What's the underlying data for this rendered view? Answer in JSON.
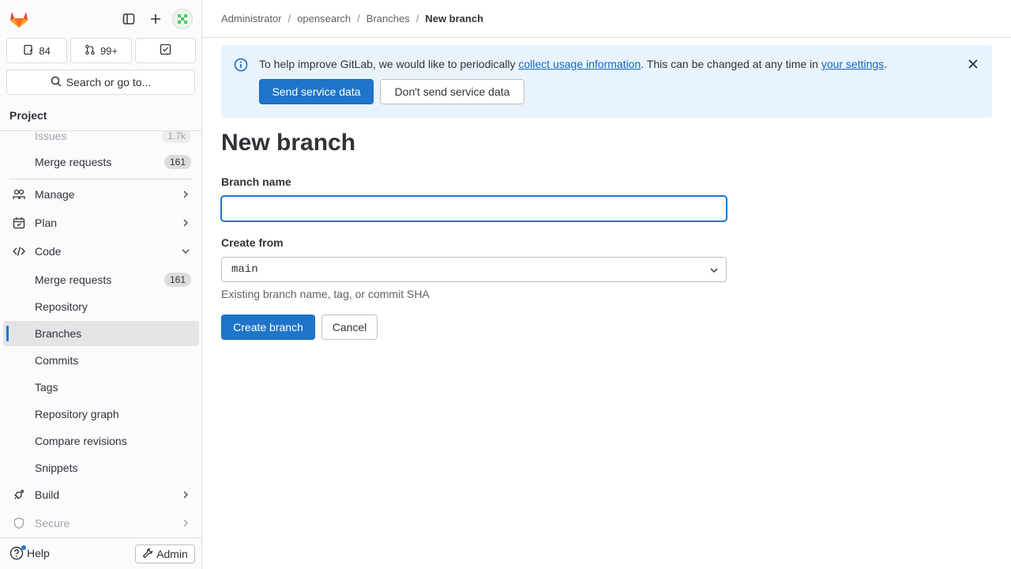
{
  "sidebar": {
    "counts": {
      "issues": "84",
      "merge_requests": "99+"
    },
    "search_label": "Search or go to...",
    "section_title": "Project",
    "items": [
      {
        "label": "Issues",
        "badge": "1.7k"
      },
      {
        "label": "Merge requests",
        "badge": "161"
      },
      {
        "label": "Manage"
      },
      {
        "label": "Plan"
      },
      {
        "label": "Code"
      },
      {
        "label": "Merge requests",
        "badge": "161"
      },
      {
        "label": "Repository"
      },
      {
        "label": "Branches"
      },
      {
        "label": "Commits"
      },
      {
        "label": "Tags"
      },
      {
        "label": "Repository graph"
      },
      {
        "label": "Compare revisions"
      },
      {
        "label": "Snippets"
      },
      {
        "label": "Build"
      },
      {
        "label": "Secure"
      }
    ],
    "help_label": "Help",
    "admin_label": "Admin"
  },
  "breadcrumb": [
    "Administrator",
    "opensearch",
    "Branches",
    "New branch"
  ],
  "alert": {
    "text_before": "To help improve GitLab, we would like to periodically ",
    "link1": "collect usage information",
    "text_middle": ". This can be changed at any time in ",
    "link2": "your settings",
    "text_after": ".",
    "send_label": "Send service data",
    "dont_send_label": "Don't send service data"
  },
  "page_title": "New branch",
  "form": {
    "branch_name_label": "Branch name",
    "branch_name_value": "",
    "create_from_label": "Create from",
    "create_from_value": "main",
    "create_from_help": "Existing branch name, tag, or commit SHA",
    "create_label": "Create branch",
    "cancel_label": "Cancel"
  },
  "colors": {
    "primary": "#1f75cb",
    "alert_bg": "#e9f3fc",
    "link": "#1068bf"
  }
}
